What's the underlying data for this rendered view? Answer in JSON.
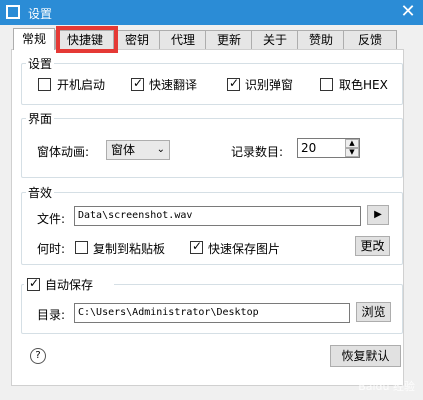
{
  "window": {
    "title": "设置",
    "close_glyph": "✕"
  },
  "tabs": [
    {
      "label": "常规"
    },
    {
      "label": "快捷键"
    },
    {
      "label": "密钥"
    },
    {
      "label": "代理"
    },
    {
      "label": "更新"
    },
    {
      "label": "关于"
    },
    {
      "label": "赞助"
    },
    {
      "label": "反馈"
    }
  ],
  "settings": {
    "title": "设置",
    "startup": {
      "label": "开机启动",
      "checked": false
    },
    "quick_translate": {
      "label": "快速翻译",
      "checked": true
    },
    "recognize_window": {
      "label": "识别弹窗",
      "checked": true
    },
    "color_hex": {
      "label": "取色HEX",
      "checked": false
    }
  },
  "interface": {
    "title": "界面",
    "animation_label": "窗体动画:",
    "animation_value": "窗体",
    "record_label": "记录数目:",
    "record_value": "20"
  },
  "sound": {
    "title": "音效",
    "file_label": "文件:",
    "file_value": "Data\\screenshot.wav",
    "play_glyph": "▶",
    "when_label": "何时:",
    "copy_clipboard": {
      "label": "复制到粘贴板",
      "checked": false
    },
    "quick_save": {
      "label": "快速保存图片",
      "checked": true
    },
    "change_button": "更改"
  },
  "autosave": {
    "title": "自动保存",
    "checked": true,
    "dir_label": "目录:",
    "dir_value": "C:\\Users\\Administrator\\Desktop",
    "browse_button": "浏览"
  },
  "footer": {
    "help_glyph": "?",
    "restore_button": "恢复默认"
  },
  "watermark": "Baidu 经验",
  "colors": {
    "titlebar": "#2b8cd6",
    "highlight": "#e53935"
  }
}
